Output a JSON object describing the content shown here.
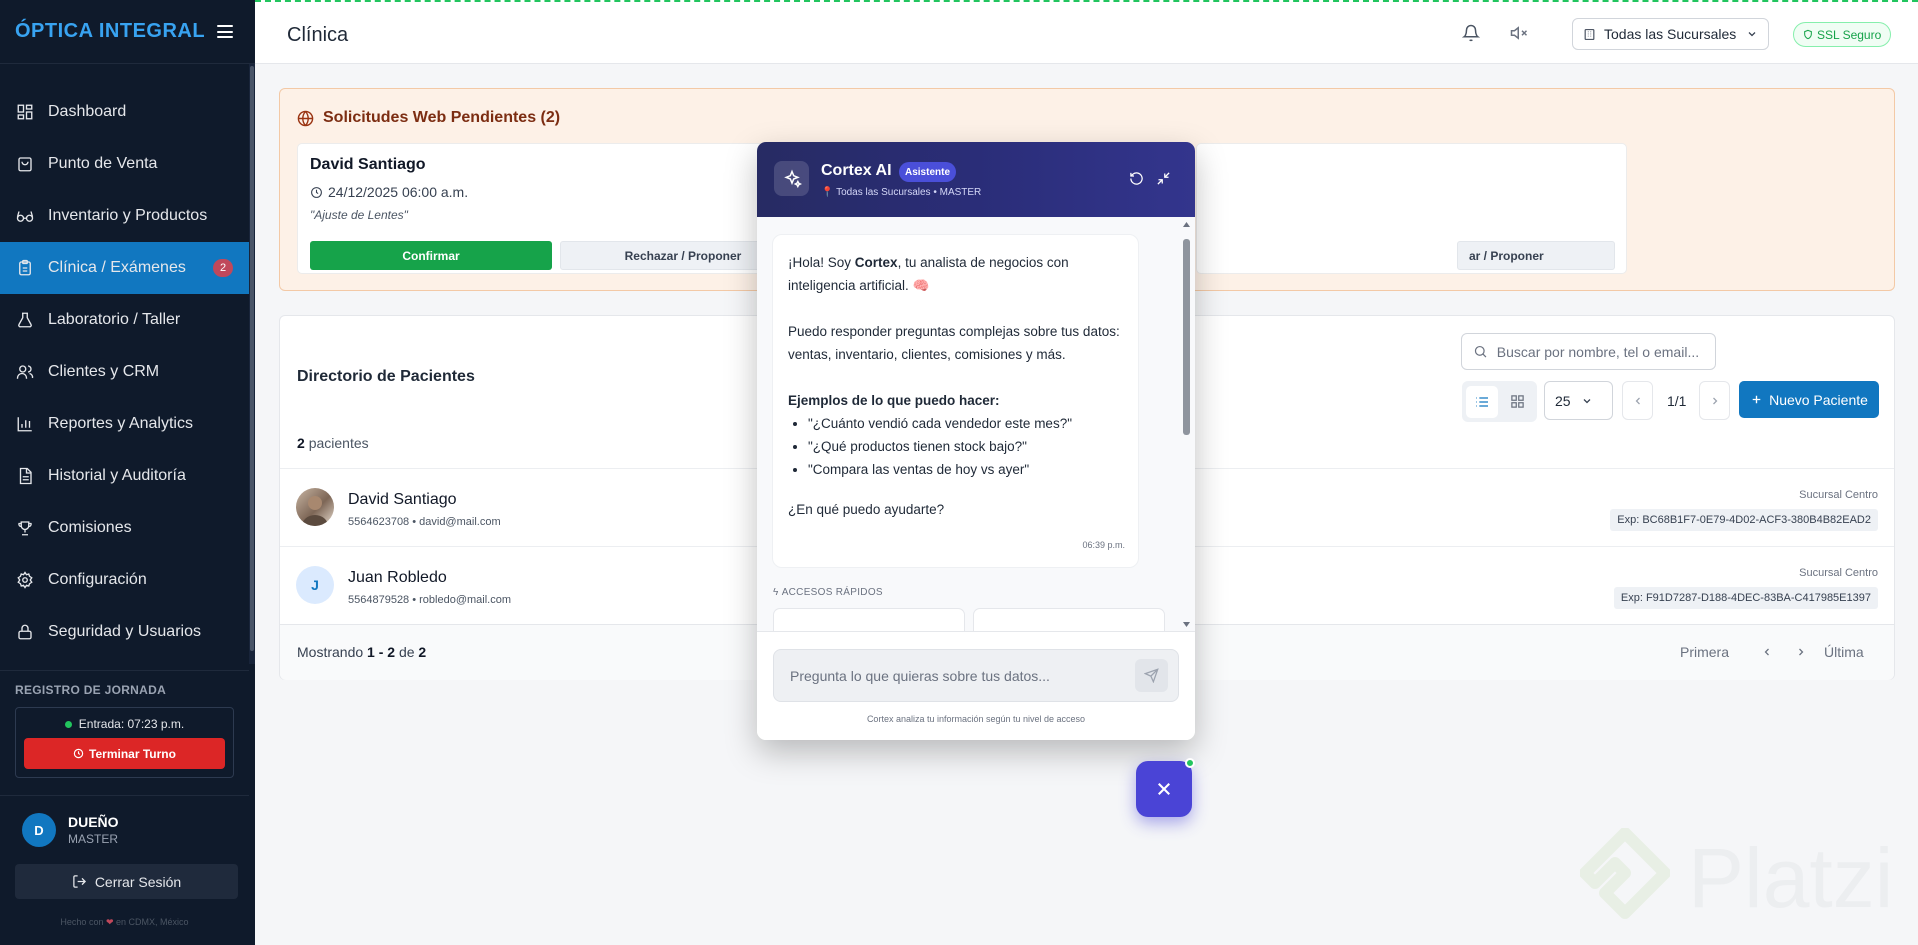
{
  "app": {
    "brand": "ÓPTICA INTEGRAL"
  },
  "sidebar": {
    "items": [
      {
        "label": "Dashboard",
        "icon": "grid-icon"
      },
      {
        "label": "Punto de Venta",
        "icon": "cart-icon"
      },
      {
        "label": "Inventario y Productos",
        "icon": "glasses-icon"
      },
      {
        "label": "Clínica / Exámenes",
        "icon": "clipboard-icon",
        "badge": "2",
        "active": true
      },
      {
        "label": "Laboratorio / Taller",
        "icon": "flask-icon"
      },
      {
        "label": "Clientes y CRM",
        "icon": "users-icon"
      },
      {
        "label": "Reportes y Analytics",
        "icon": "chart-icon"
      },
      {
        "label": "Historial y Auditoría",
        "icon": "document-icon"
      },
      {
        "label": "Comisiones",
        "icon": "trophy-icon"
      },
      {
        "label": "Configuración",
        "icon": "gear-icon"
      },
      {
        "label": "Seguridad y Usuarios",
        "icon": "lock-icon"
      }
    ],
    "jornada": {
      "title": "REGISTRO DE JORNADA",
      "entrada": "Entrada: 07:23 p.m.",
      "end_shift": "Terminar Turno"
    },
    "user": {
      "initial": "D",
      "name": "DUEÑO",
      "role": "MASTER"
    },
    "logout": "Cerrar Sesión",
    "footer_pre": "Hecho con",
    "footer_post": "en CDMX, México"
  },
  "header": {
    "title": "Clínica",
    "branch": "Todas las Sucursales",
    "ssl": "SSL Seguro"
  },
  "requests": {
    "title": "Solicitudes Web Pendientes (2)",
    "cards": [
      {
        "name": "David Santiago",
        "date": "24/12/2025 06:00 a.m.",
        "note": "\"Ajuste de Lentes\"",
        "confirm": "Confirmar",
        "reject": "Rechazar / Proponer"
      },
      {
        "reject": "ar / Proponer"
      }
    ]
  },
  "directory": {
    "title": "Directorio de Pacientes",
    "count": "2",
    "count_label": "pacientes",
    "search_placeholder": "Buscar por nombre, tel o email...",
    "per_page": "25",
    "page": "1/1",
    "new_button": "Nuevo Paciente",
    "patients": [
      {
        "name": "David Santiago",
        "meta": "5564623708 • david@mail.com",
        "branch": "Sucursal Centro",
        "exp": "Exp: BC68B1F7-0E79-4D02-ACF3-380B4B82EAD2",
        "initial": ""
      },
      {
        "name": "Juan Robledo",
        "meta": "5564879528 • robledo@mail.com",
        "branch": "Sucursal Centro",
        "exp": "Exp: F91D7287-D188-4DEC-83BA-C417985E1397",
        "initial": "J"
      }
    ],
    "showing_prefix": "Mostrando",
    "showing_range": "1 - 2",
    "showing_of": "de",
    "showing_total": "2",
    "first": "Primera",
    "last": "Última"
  },
  "chat": {
    "title": "Cortex AI",
    "tag": "Asistente",
    "subtitle": "Todas las Sucursales • MASTER",
    "greeting_pre": "¡Hola! Soy",
    "greeting_name": "Cortex",
    "greeting_post": ", tu analista de negocios con inteligencia artificial.",
    "paragraph2": "Puedo responder preguntas complejas sobre tus datos: ventas, inventario, clientes, comisiones y más.",
    "examples_title": "Ejemplos de lo que puedo hacer:",
    "examples": [
      "\"¿Cuánto vendió cada vendedor este mes?\"",
      "\"¿Qué productos tienen stock bajo?\"",
      "\"Compara las ventas de hoy vs ayer\""
    ],
    "question": "¿En qué puedo ayudarte?",
    "time": "06:39 p.m.",
    "quick_title": "ACCESOS RÁPIDOS",
    "input_placeholder": "Pregunta lo que quieras sobre tus datos...",
    "note": "Cortex analiza tu información según tu nivel de acceso"
  },
  "watermark": "Platzi",
  "colors": {
    "primary": "#1177c0",
    "sidebar": "#0f1a2b",
    "success": "#16a34a",
    "danger": "#dc2626",
    "chat_accent": "#4a44d6"
  }
}
